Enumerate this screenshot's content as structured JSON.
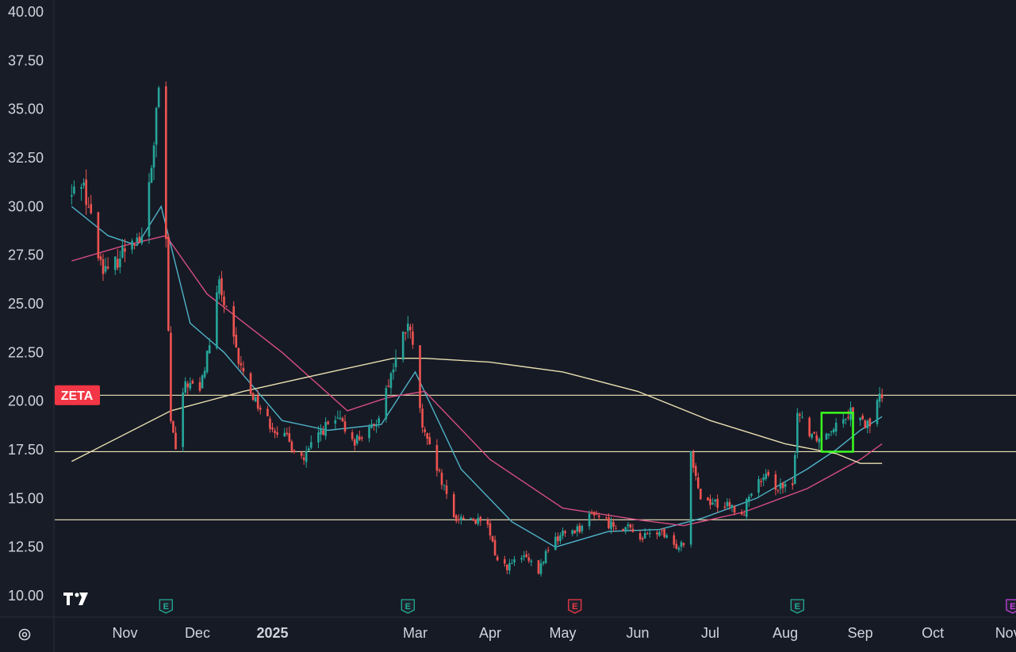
{
  "chart_data": {
    "type": "candlestick",
    "ticker": "ZETA",
    "ylim": [
      9.5,
      40.5
    ],
    "y_ticks": [
      "40.00",
      "37.50",
      "35.00",
      "32.50",
      "30.00",
      "27.50",
      "25.00",
      "22.50",
      "20.00",
      "17.50",
      "15.00",
      "12.50",
      "10.00"
    ],
    "x_ticks": [
      {
        "label": "Nov",
        "date": "2024-11-01"
      },
      {
        "label": "Dec",
        "date": "2024-12-01"
      },
      {
        "label": "2025",
        "date": "2025-01-01"
      },
      {
        "label": "Mar",
        "date": "2025-03-01"
      },
      {
        "label": "Apr",
        "date": "2025-04-01"
      },
      {
        "label": "May",
        "date": "2025-05-01"
      },
      {
        "label": "Jun",
        "date": "2025-06-01"
      },
      {
        "label": "Jul",
        "date": "2025-07-01"
      },
      {
        "label": "Aug",
        "date": "2025-08-01"
      },
      {
        "label": "Sep",
        "date": "2025-09-01"
      },
      {
        "label": "Oct",
        "date": "2025-10-01"
      },
      {
        "label": "Nov",
        "date": "2025-11-01"
      }
    ],
    "horizontal_lines": [
      20.3,
      17.4,
      13.9
    ],
    "last_price": 20.3,
    "earnings_markers": [
      {
        "date": "2024-11-18",
        "label": "E",
        "status": "past"
      },
      {
        "date": "2025-02-26",
        "label": "E",
        "status": "past"
      },
      {
        "date": "2025-05-06",
        "label": "E",
        "status": "past-miss"
      },
      {
        "date": "2025-08-06",
        "label": "E",
        "status": "past"
      },
      {
        "date": "2025-11-03",
        "label": "E",
        "status": "upcoming"
      }
    ],
    "highlight_box": {
      "x_start": "2025-08-16",
      "x_end": "2025-08-29",
      "y_low": 17.4,
      "y_high": 19.4
    },
    "anchors": [
      [
        "2024-10-10",
        30.5
      ],
      [
        "2024-10-14",
        31.5
      ],
      [
        "2024-10-17",
        30.0
      ],
      [
        "2024-10-21",
        27.5
      ],
      [
        "2024-10-25",
        26.5
      ],
      [
        "2024-10-30",
        27.5
      ],
      [
        "2024-11-04",
        28.5
      ],
      [
        "2024-11-08",
        28.2
      ],
      [
        "2024-11-12",
        32.0
      ],
      [
        "2024-11-15",
        36.0
      ],
      [
        "2024-11-18",
        28.0
      ],
      [
        "2024-11-20",
        19.0
      ],
      [
        "2024-11-22",
        17.5
      ],
      [
        "2024-11-26",
        21.0
      ],
      [
        "2024-12-02",
        20.5
      ],
      [
        "2024-12-06",
        23.0
      ],
      [
        "2024-12-10",
        26.0
      ],
      [
        "2024-12-14",
        24.0
      ],
      [
        "2024-12-18",
        22.0
      ],
      [
        "2024-12-23",
        20.5
      ],
      [
        "2024-12-30",
        19.0
      ],
      [
        "2025-01-07",
        18.0
      ],
      [
        "2025-01-14",
        17.0
      ],
      [
        "2025-01-21",
        18.5
      ],
      [
        "2025-01-28",
        19.0
      ],
      [
        "2025-02-04",
        18.0
      ],
      [
        "2025-02-12",
        18.6
      ],
      [
        "2025-02-18",
        21.0
      ],
      [
        "2025-02-22",
        22.5
      ],
      [
        "2025-02-26",
        24.0
      ],
      [
        "2025-03-01",
        22.0
      ],
      [
        "2025-03-04",
        18.5
      ],
      [
        "2025-03-10",
        16.5
      ],
      [
        "2025-03-17",
        14.0
      ],
      [
        "2025-03-24",
        14.0
      ],
      [
        "2025-03-31",
        13.5
      ],
      [
        "2025-04-04",
        11.8
      ],
      [
        "2025-04-08",
        11.5
      ],
      [
        "2025-04-15",
        12.0
      ],
      [
        "2025-04-21",
        11.2
      ],
      [
        "2025-04-25",
        12.5
      ],
      [
        "2025-05-01",
        13.2
      ],
      [
        "2025-05-08",
        13.5
      ],
      [
        "2025-05-14",
        14.3
      ],
      [
        "2025-05-20",
        13.7
      ],
      [
        "2025-05-27",
        13.5
      ],
      [
        "2025-06-03",
        13.0
      ],
      [
        "2025-06-10",
        13.3
      ],
      [
        "2025-06-16",
        12.5
      ],
      [
        "2025-06-20",
        12.8
      ],
      [
        "2025-06-23",
        17.5
      ],
      [
        "2025-06-27",
        15.0
      ],
      [
        "2025-07-03",
        14.8
      ],
      [
        "2025-07-10",
        14.5
      ],
      [
        "2025-07-14",
        14.0
      ],
      [
        "2025-07-18",
        15.5
      ],
      [
        "2025-07-24",
        16.0
      ],
      [
        "2025-07-31",
        15.5
      ],
      [
        "2025-08-04",
        15.5
      ],
      [
        "2025-08-06",
        19.5
      ],
      [
        "2025-08-11",
        18.5
      ],
      [
        "2025-08-16",
        18.0
      ],
      [
        "2025-08-22",
        19.0
      ],
      [
        "2025-08-28",
        19.5
      ],
      [
        "2025-09-02",
        18.8
      ],
      [
        "2025-09-06",
        18.8
      ],
      [
        "2025-09-08",
        20.0
      ],
      [
        "2025-09-10",
        20.3
      ]
    ],
    "moving_averages": [
      {
        "name": "short",
        "color": "#4fb3c8",
        "points": [
          [
            "2024-10-10",
            30.0
          ],
          [
            "2024-10-25",
            28.5
          ],
          [
            "2024-11-06",
            28.0
          ],
          [
            "2024-11-16",
            30.0
          ],
          [
            "2024-11-28",
            24.0
          ],
          [
            "2024-12-12",
            22.5
          ],
          [
            "2025-01-05",
            19.0
          ],
          [
            "2025-01-24",
            18.5
          ],
          [
            "2025-02-15",
            18.8
          ],
          [
            "2025-03-01",
            21.5
          ],
          [
            "2025-03-20",
            16.5
          ],
          [
            "2025-04-10",
            13.8
          ],
          [
            "2025-04-28",
            12.5
          ],
          [
            "2025-05-20",
            13.3
          ],
          [
            "2025-06-10",
            13.4
          ],
          [
            "2025-06-28",
            14.0
          ],
          [
            "2025-07-20",
            15.0
          ],
          [
            "2025-08-10",
            16.5
          ],
          [
            "2025-08-22",
            17.5
          ],
          [
            "2025-09-01",
            18.5
          ],
          [
            "2025-09-10",
            19.2
          ]
        ]
      },
      {
        "name": "medium",
        "color": "#d64d82",
        "points": [
          [
            "2024-10-10",
            27.2
          ],
          [
            "2024-11-01",
            28.0
          ],
          [
            "2024-11-18",
            28.5
          ],
          [
            "2024-12-05",
            25.5
          ],
          [
            "2025-01-05",
            22.5
          ],
          [
            "2025-02-01",
            19.5
          ],
          [
            "2025-02-18",
            20.2
          ],
          [
            "2025-03-05",
            20.5
          ],
          [
            "2025-04-01",
            17.0
          ],
          [
            "2025-05-01",
            14.5
          ],
          [
            "2025-06-01",
            13.9
          ],
          [
            "2025-06-20",
            13.6
          ],
          [
            "2025-07-15",
            14.3
          ],
          [
            "2025-08-10",
            15.5
          ],
          [
            "2025-09-01",
            17.0
          ],
          [
            "2025-09-10",
            17.8
          ]
        ]
      },
      {
        "name": "long",
        "color": "#e8dfb0",
        "points": [
          [
            "2024-10-10",
            16.9
          ],
          [
            "2024-11-20",
            19.5
          ],
          [
            "2024-12-20",
            20.5
          ],
          [
            "2025-01-25",
            21.5
          ],
          [
            "2025-02-20",
            22.2
          ],
          [
            "2025-03-05",
            22.2
          ],
          [
            "2025-04-01",
            22.0
          ],
          [
            "2025-05-01",
            21.5
          ],
          [
            "2025-06-01",
            20.5
          ],
          [
            "2025-07-01",
            19.0
          ],
          [
            "2025-08-01",
            17.8
          ],
          [
            "2025-08-22",
            17.3
          ],
          [
            "2025-09-01",
            16.8
          ],
          [
            "2025-09-10",
            16.8
          ]
        ]
      }
    ]
  }
}
